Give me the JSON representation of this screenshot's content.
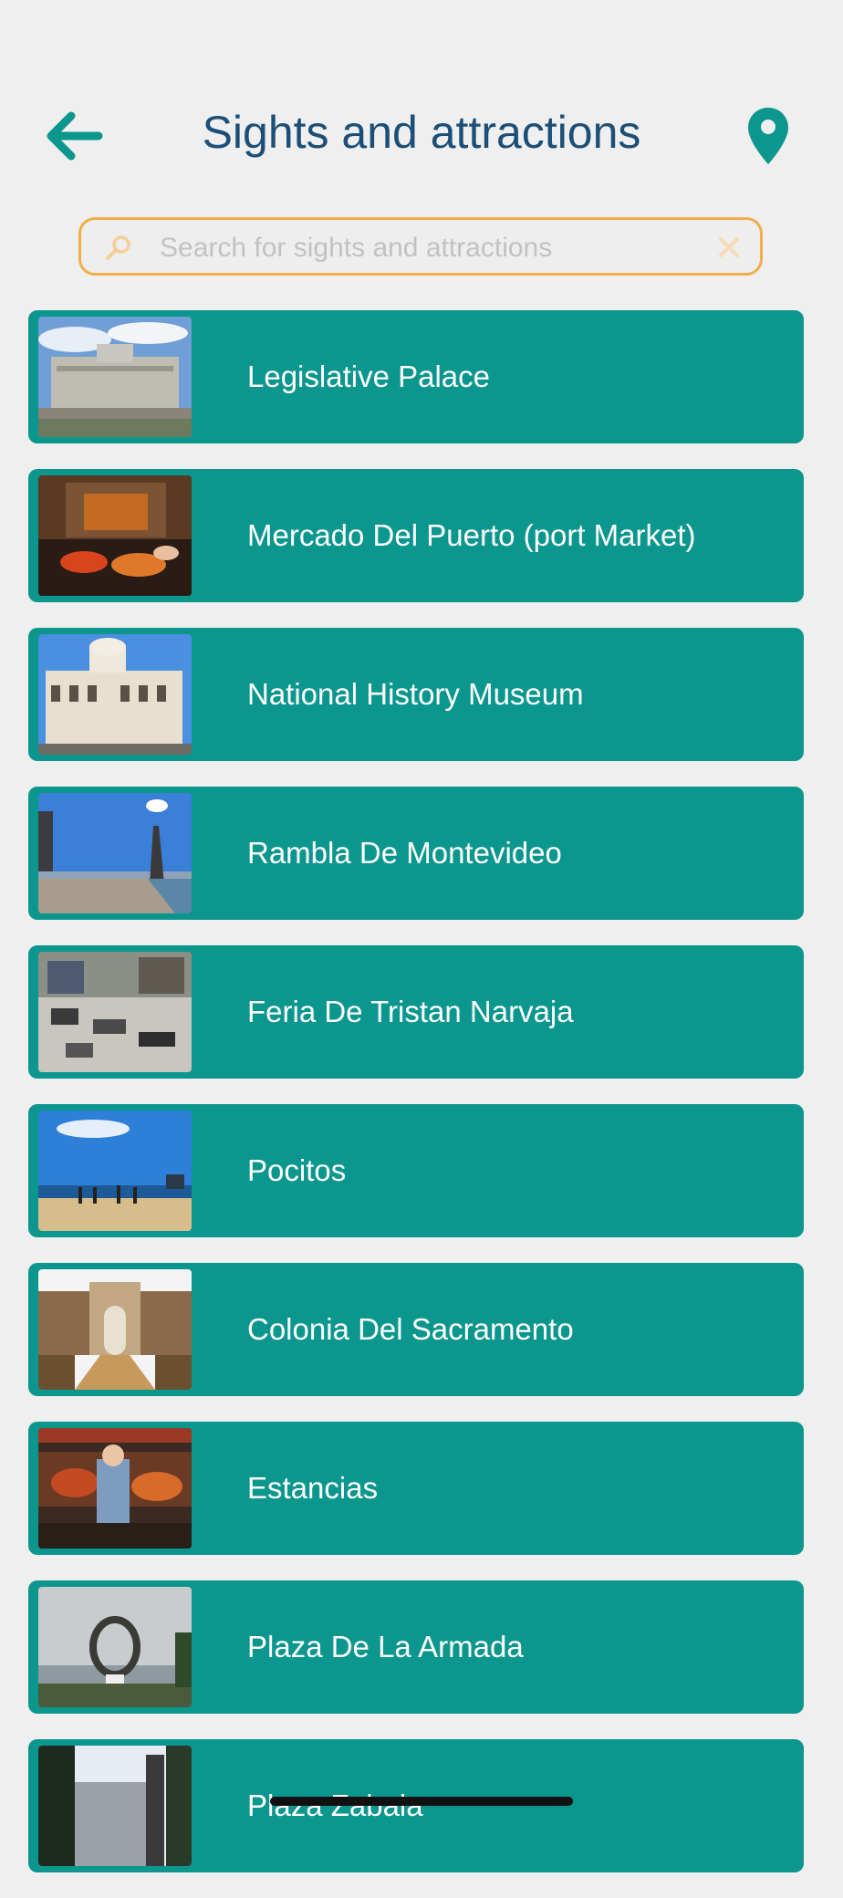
{
  "header": {
    "title": "Sights and attractions",
    "back_icon": "arrow-left-icon",
    "map_icon": "map-pin-icon"
  },
  "search": {
    "placeholder": "Search for sights and attractions",
    "value": ""
  },
  "colors": {
    "accent": "#0b968e",
    "title": "#1c4f78",
    "search_border": "#f1ae4a",
    "background": "#efefef"
  },
  "attractions": [
    {
      "label": "Legislative Palace",
      "thumb": "legislative-palace-photo"
    },
    {
      "label": "Mercado Del Puerto (port Market)",
      "thumb": "mercado-del-puerto-photo"
    },
    {
      "label": "National History Museum",
      "thumb": "national-history-museum-photo"
    },
    {
      "label": "Rambla De Montevideo",
      "thumb": "rambla-de-montevideo-photo"
    },
    {
      "label": "Feria De Tristan Narvaja",
      "thumb": "feria-de-tristan-narvaja-photo"
    },
    {
      "label": "Pocitos",
      "thumb": "pocitos-photo"
    },
    {
      "label": "Colonia Del Sacramento",
      "thumb": "colonia-del-sacramento-photo"
    },
    {
      "label": "Estancias",
      "thumb": "estancias-photo"
    },
    {
      "label": "Plaza De La Armada",
      "thumb": "plaza-de-la-armada-photo"
    },
    {
      "label": "Plaza Zabala",
      "thumb": "plaza-zabala-photo"
    }
  ]
}
